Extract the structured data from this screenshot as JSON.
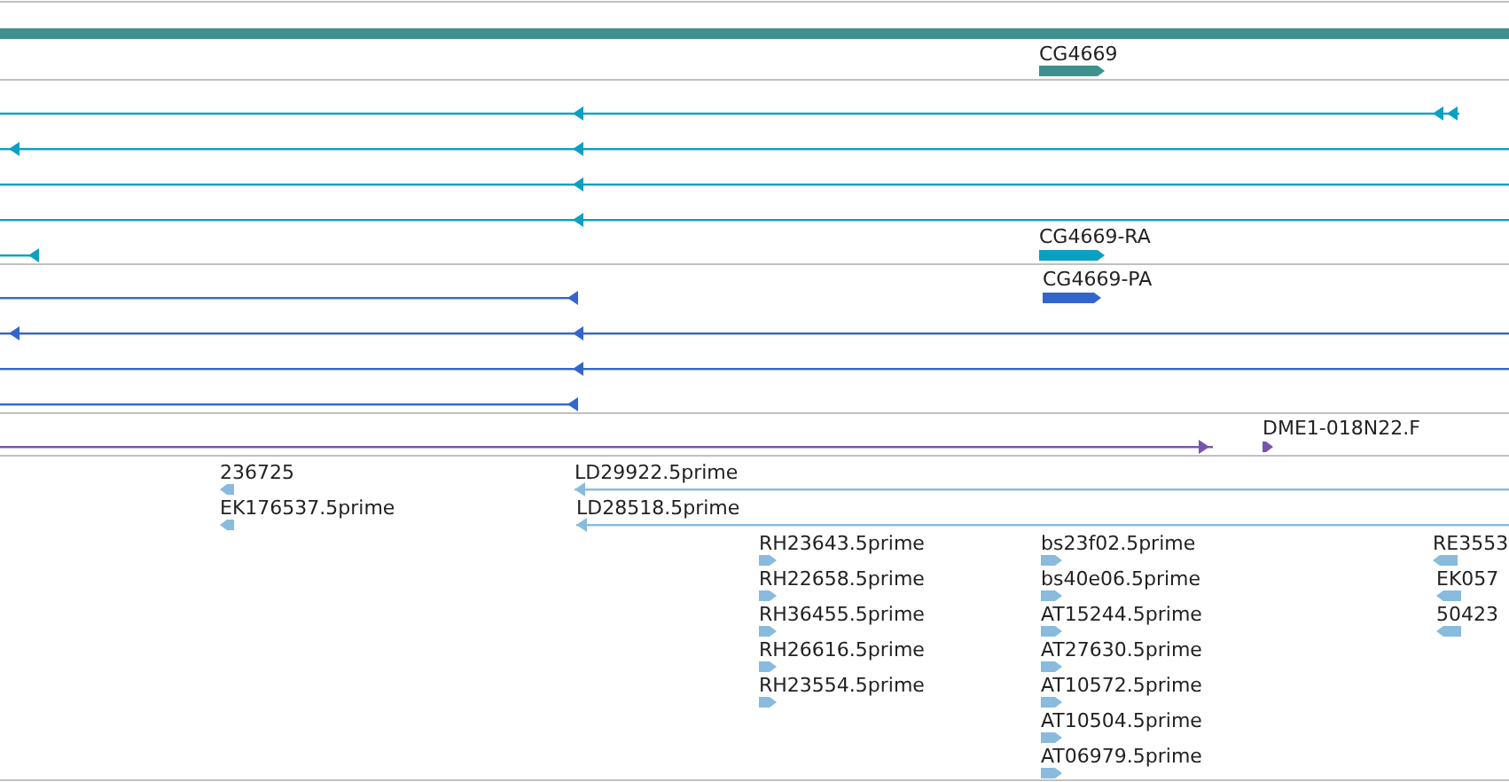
{
  "tracks": [
    {
      "kind": "gene",
      "color": "#3f8f8f",
      "features": [
        {
          "label": "CG4669",
          "reverse": false
        }
      ]
    },
    {
      "kind": "transcript",
      "color": "#0aa0c4",
      "features": [
        {
          "reverse": true
        },
        {
          "reverse": true
        },
        {
          "reverse": true
        },
        {
          "reverse": true
        },
        {
          "reverse": true
        },
        {
          "label": "CG4669-RA",
          "reverse": false
        }
      ]
    },
    {
      "kind": "transcript",
      "color": "#3366cc",
      "features": [
        {
          "reverse": true
        },
        {
          "reverse": true
        },
        {
          "reverse": true
        },
        {
          "reverse": true
        },
        {
          "label": "CG4669-PA",
          "reverse": false
        }
      ]
    },
    {
      "kind": "clone",
      "color": "#7755aa",
      "features": [
        {
          "reverse": false
        },
        {
          "label": "DME1-018N22.F",
          "reverse": false
        }
      ]
    },
    {
      "kind": "est",
      "color": "#88bbdd",
      "features": [
        {
          "label": "236725",
          "reverse": true
        },
        {
          "label": "EK176537.5prime",
          "reverse": true
        },
        {
          "label": "LD29922.5prime",
          "reverse": true
        },
        {
          "label": "LD28518.5prime",
          "reverse": true
        },
        {
          "label": "RH23643.5prime",
          "reverse": false
        },
        {
          "label": "RH22658.5prime",
          "reverse": false
        },
        {
          "label": "RH36455.5prime",
          "reverse": false
        },
        {
          "label": "RH26616.5prime",
          "reverse": false
        },
        {
          "label": "RH23554.5prime",
          "reverse": false
        },
        {
          "label": "bs23f02.5prime",
          "reverse": false
        },
        {
          "label": "bs40e06.5prime",
          "reverse": false
        },
        {
          "label": "AT15244.5prime",
          "reverse": false
        },
        {
          "label": "AT27630.5prime",
          "reverse": false
        },
        {
          "label": "AT10572.5prime",
          "reverse": false
        },
        {
          "label": "AT10504.5prime",
          "reverse": false
        },
        {
          "label": "AT06979.5prime",
          "reverse": false
        },
        {
          "label": "RE3553",
          "reverse": true
        },
        {
          "label": "EK057",
          "reverse": true
        },
        {
          "label": "50423",
          "reverse": true
        }
      ]
    }
  ]
}
